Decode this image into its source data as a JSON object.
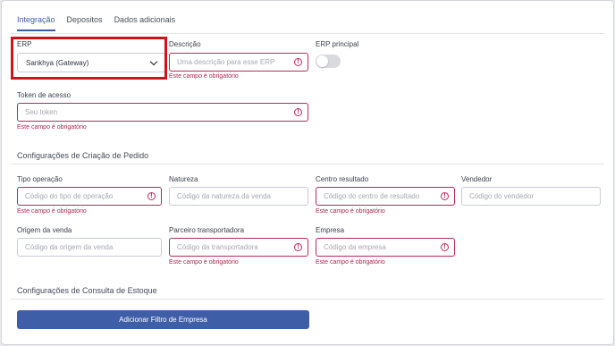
{
  "tabs": [
    {
      "label": "Integração",
      "active": true
    },
    {
      "label": "Depositos",
      "active": false
    },
    {
      "label": "Dados adicionais",
      "active": false
    }
  ],
  "erp": {
    "label": "ERP",
    "selected": "Sankhya (Gateway)"
  },
  "descricao": {
    "label": "Descrição",
    "placeholder": "Uma descrição para esse ERP",
    "error": "Este campo é obrigatório"
  },
  "erp_principal": {
    "label": "ERP principal",
    "enabled": false
  },
  "token": {
    "label": "Token de acesso",
    "placeholder": "Seu token",
    "error": "Este campo é obrigatório"
  },
  "pedido_section": {
    "title": "Configurações de Criação de Pedido"
  },
  "tipo_operacao": {
    "label": "Tipo operação",
    "placeholder": "Código do tipo de operação",
    "error": "Este campo é obrigatório"
  },
  "natureza": {
    "label": "Natureza",
    "placeholder": "Código da natureza da venda"
  },
  "centro_resultado": {
    "label": "Centro resultado",
    "placeholder": "Código do centro de resultado",
    "error": "Este campo é obrigatório"
  },
  "vendedor": {
    "label": "Vendedor",
    "placeholder": "Código do vendedor"
  },
  "origem_venda": {
    "label": "Origem da venda",
    "placeholder": "Código da origem da venda"
  },
  "parceiro_transportadora": {
    "label": "Parceiro transportadora",
    "placeholder": "Código da transportadora",
    "error": "Este campo é obrigatório"
  },
  "empresa": {
    "label": "Empresa",
    "placeholder": "Código da empresa",
    "error": "Este campo é obrigatório"
  },
  "estoque_section": {
    "title": "Configurações de Consulta de Estoque"
  },
  "add_filter_button": {
    "label": "Adicionar Filtro de Empresa"
  },
  "colors": {
    "accent": "#3f5ea8",
    "error": "#b62a5a",
    "highlight": "#d0131b"
  }
}
